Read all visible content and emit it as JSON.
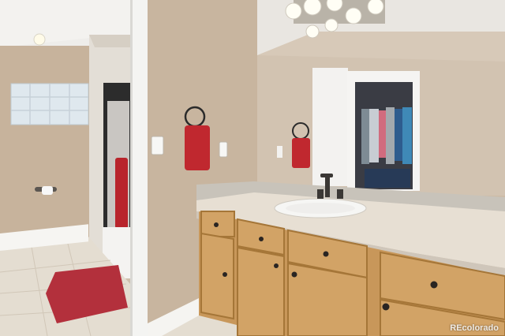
{
  "photo": {
    "subject": "bathroom",
    "watermark_text": "REcolorado"
  },
  "colors": {
    "wall": "#cbb9a3",
    "ceiling": "#ecebe8",
    "tile_floor": "#e3dbcf",
    "vanity_wood": "#c89a5c",
    "countertop": "#e7dfd3",
    "towel": "#c0282f",
    "rug": "#b3303c",
    "baseboard": "#f6f5f2"
  }
}
